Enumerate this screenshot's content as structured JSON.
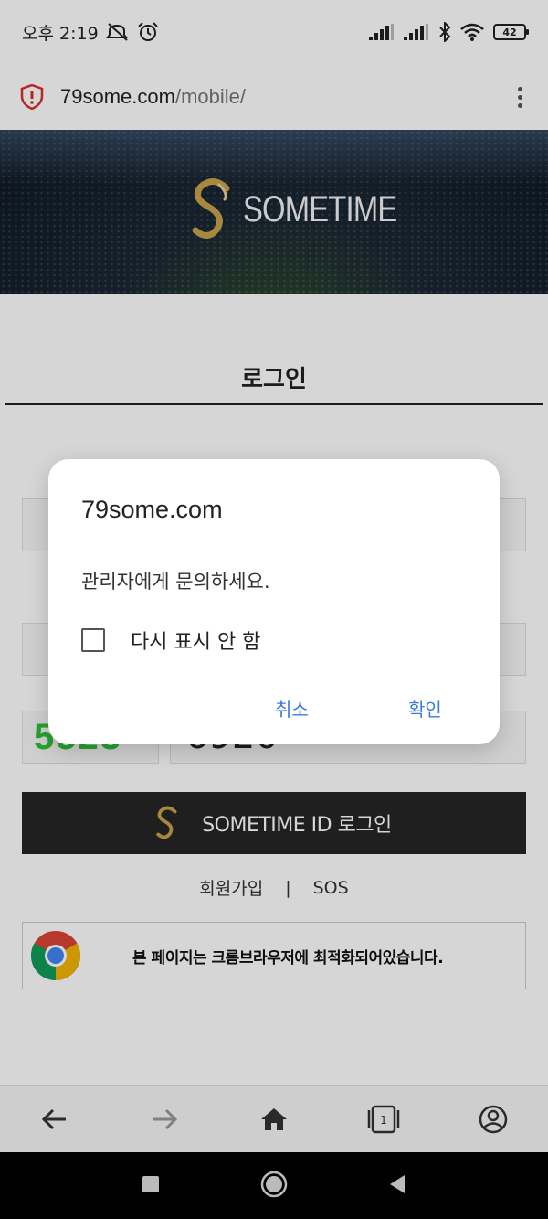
{
  "status_bar": {
    "time": "오후 2:19",
    "battery": "42",
    "icons": [
      "mute-icon",
      "alarm-icon",
      "signal-icon",
      "signal-icon",
      "bluetooth-icon",
      "wifi-icon",
      "battery-icon"
    ]
  },
  "browser": {
    "url_domain": "79some.com",
    "url_path": "/mobile/",
    "security_icon": "shield-alert-icon",
    "menu_icon": "more-vert-icon"
  },
  "banner": {
    "logo_text": "SOMETIME",
    "colors": {
      "logo_gold": "#c9a24a",
      "sky": "#0d1822"
    }
  },
  "login": {
    "title": "로그인",
    "captcha_image_text": "5523",
    "captcha_value": "6920",
    "button_label": "SOMETIME ID 로그인",
    "links": [
      "회원가입",
      "|",
      "SOS"
    ],
    "chrome_notice": "본 페이지는 크롬브라우저에 최적화되어있습니다."
  },
  "dialog": {
    "title": "79some.com",
    "message": "관리자에게 문의하세요.",
    "checkbox_label": "다시 표시 안 함",
    "checkbox_checked": false,
    "cancel_label": "취소",
    "ok_label": "확인",
    "accent_color": "#3b7cd8"
  },
  "toolbar": {
    "icons": [
      "back-icon",
      "forward-icon",
      "home-icon",
      "tabs-icon",
      "account-icon"
    ],
    "tab_count": "1"
  },
  "android_nav": {
    "icons": [
      "recents-icon",
      "home-circle-icon",
      "back-triangle-icon"
    ]
  }
}
